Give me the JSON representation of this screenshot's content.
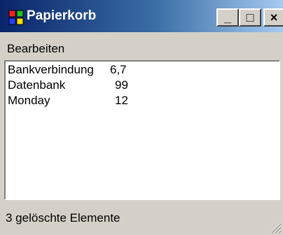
{
  "window": {
    "title": "Papierkorb",
    "buttons": {
      "minimize": "_",
      "maximize": "□",
      "close": "×"
    }
  },
  "menu": {
    "items": [
      {
        "label": "Bearbeiten"
      }
    ]
  },
  "list": {
    "items": [
      {
        "name": "Bankverbindung",
        "value": "6,7"
      },
      {
        "name": "Datenbank",
        "value": "99"
      },
      {
        "name": "Monday",
        "value": "12"
      }
    ]
  },
  "status": {
    "text": "3 gelöschte Elemente"
  }
}
